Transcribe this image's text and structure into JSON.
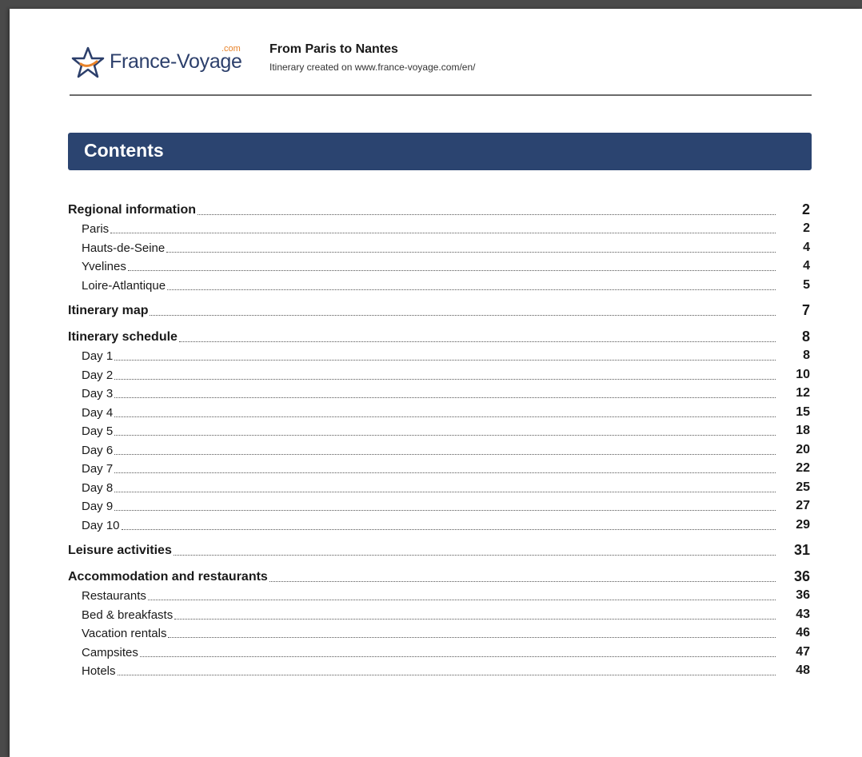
{
  "header": {
    "logo_text": "France-Voyage",
    "logo_suffix": ".com",
    "title": "From Paris to Nantes",
    "subtitle": "Itinerary created on www.france-voyage.com/en/"
  },
  "banner": {
    "title": "Contents"
  },
  "toc": [
    {
      "label": "Regional information",
      "page": "2",
      "items": [
        {
          "label": "Paris",
          "page": "2"
        },
        {
          "label": "Hauts-de-Seine",
          "page": "4"
        },
        {
          "label": "Yvelines",
          "page": "4"
        },
        {
          "label": "Loire-Atlantique",
          "page": "5"
        }
      ]
    },
    {
      "label": "Itinerary map",
      "page": "7",
      "items": []
    },
    {
      "label": "Itinerary schedule",
      "page": "8",
      "items": [
        {
          "label": "Day 1",
          "page": "8"
        },
        {
          "label": "Day 2",
          "page": "10"
        },
        {
          "label": "Day 3",
          "page": "12"
        },
        {
          "label": "Day 4",
          "page": "15"
        },
        {
          "label": "Day 5",
          "page": "18"
        },
        {
          "label": "Day 6",
          "page": "20"
        },
        {
          "label": "Day 7",
          "page": "22"
        },
        {
          "label": "Day 8",
          "page": "25"
        },
        {
          "label": "Day 9",
          "page": "27"
        },
        {
          "label": "Day 10",
          "page": "29"
        }
      ]
    },
    {
      "label": "Leisure activities",
      "page": "31",
      "items": []
    },
    {
      "label": "Accommodation and restaurants",
      "page": "36",
      "items": [
        {
          "label": "Restaurants",
          "page": "36"
        },
        {
          "label": "Bed & breakfasts",
          "page": "43"
        },
        {
          "label": "Vacation rentals",
          "page": "46"
        },
        {
          "label": "Campsites",
          "page": "47"
        },
        {
          "label": "Hotels",
          "page": "48"
        }
      ]
    }
  ]
}
